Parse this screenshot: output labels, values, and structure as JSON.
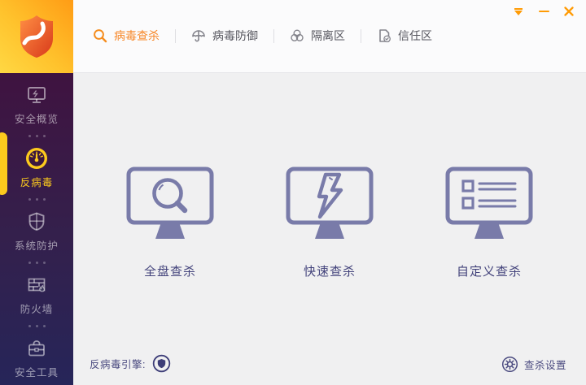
{
  "topnav": {
    "tabs": [
      {
        "label": "病毒查杀",
        "icon": "search-icon",
        "active": true
      },
      {
        "label": "病毒防御",
        "icon": "umbrella-icon",
        "active": false
      },
      {
        "label": "隔离区",
        "icon": "biohazard-icon",
        "active": false
      },
      {
        "label": "信任区",
        "icon": "trusted-file-icon",
        "active": false
      }
    ]
  },
  "sidebar": {
    "items": [
      {
        "label": "安全概览",
        "icon": "monitor-overview-icon",
        "active": false
      },
      {
        "label": "反病毒",
        "icon": "gauge-icon",
        "active": true
      },
      {
        "label": "系统防护",
        "icon": "shield-icon",
        "active": false
      },
      {
        "label": "防火墙",
        "icon": "firewall-icon",
        "active": false
      },
      {
        "label": "安全工具",
        "icon": "toolbox-icon",
        "active": false
      }
    ]
  },
  "main": {
    "scan_options": [
      {
        "label": "全盘查杀",
        "icon": "magnifier-monitor-icon"
      },
      {
        "label": "快速查杀",
        "icon": "lightning-monitor-icon"
      },
      {
        "label": "自定义查杀",
        "icon": "checklist-monitor-icon"
      }
    ],
    "footer": {
      "engine_label": "反病毒引擎:",
      "settings_label": "查杀设置"
    }
  },
  "colors": {
    "accent_orange": "#f7882a",
    "control_orange": "#ff9b05",
    "highlight_yellow": "#fcca1d",
    "sidebar_top": "#3f1340",
    "sidebar_bottom": "#262559",
    "logo_gradient_start": "#ffd843",
    "logo_gradient_end": "#ff9c15",
    "monitor_indigo": "#797ba9",
    "label_indigo": "#44447c",
    "main_background": "#f0f0f1",
    "topbar_background": "#fbfbfc"
  }
}
